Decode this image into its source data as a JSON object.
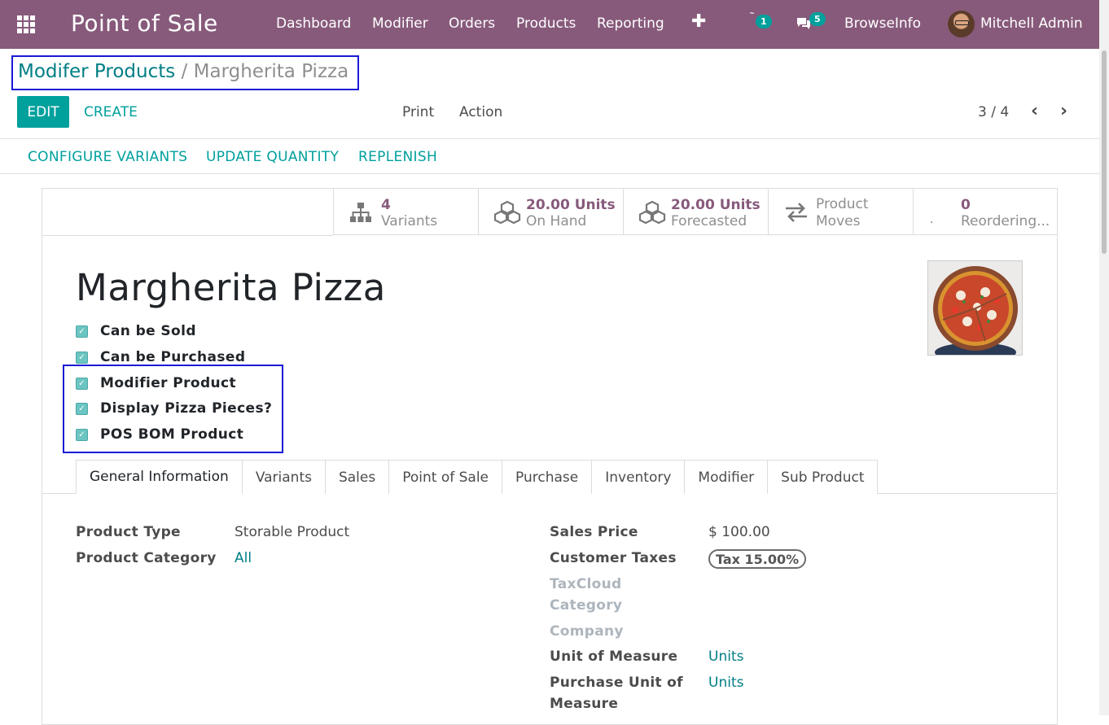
{
  "navbar": {
    "brand": "Point of Sale",
    "menu": [
      "Dashboard",
      "Modifier",
      "Orders",
      "Products",
      "Reporting"
    ],
    "activity_count": "1",
    "message_count": "5",
    "company": "BrowseInfo",
    "user": "Mitchell Admin"
  },
  "breadcrumb": {
    "parent": "Modifer Products",
    "separator": "/",
    "current": "Margherita Pizza"
  },
  "control": {
    "edit": "EDIT",
    "create": "CREATE",
    "print": "Print",
    "action": "Action",
    "pager": "3 / 4"
  },
  "statusbar": {
    "configure_variants": "CONFIGURE VARIANTS",
    "update_quantity": "UPDATE QUANTITY",
    "replenish": "REPLENISH"
  },
  "smart_buttons": {
    "variants": {
      "value": "4",
      "label": "Variants"
    },
    "on_hand": {
      "value": "20.00 Units",
      "label": "On Hand"
    },
    "forecasted": {
      "value": "20.00 Units",
      "label": "Forecasted"
    },
    "moves": {
      "line1": "Product",
      "line2": "Moves"
    },
    "reordering": {
      "value": "0",
      "label": "Reordering..."
    }
  },
  "product": {
    "name": "Margherita Pizza",
    "checkboxes": [
      "Can be Sold",
      "Can be Purchased",
      "Modifier Product",
      "Display Pizza Pieces?",
      "POS BOM Product"
    ]
  },
  "tabs": [
    "General Information",
    "Variants",
    "Sales",
    "Point of Sale",
    "Purchase",
    "Inventory",
    "Modifier",
    "Sub Product"
  ],
  "fields": {
    "product_type_label": "Product Type",
    "product_type_value": "Storable Product",
    "product_category_label": "Product Category",
    "product_category_value": "All",
    "sales_price_label": "Sales Price",
    "sales_price_value": "$ 100.00",
    "customer_taxes_label": "Customer Taxes",
    "customer_taxes_value": "Tax 15.00%",
    "taxcloud_label_1": "TaxCloud",
    "taxcloud_label_2": "Category",
    "company_label": "Company",
    "uom_label": "Unit of Measure",
    "uom_value": "Units",
    "purchase_uom_label_1": "Purchase Unit of",
    "purchase_uom_label_2": "Measure",
    "purchase_uom_value": "Units"
  },
  "colors": {
    "navbar": "#875a7b",
    "accent": "#00a09d",
    "link": "#017e84",
    "highlight": "#1a1ad6"
  }
}
